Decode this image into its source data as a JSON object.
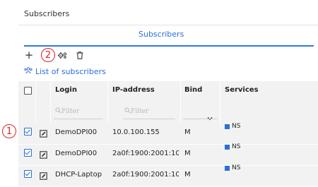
{
  "panel": {
    "title": "Subscribers"
  },
  "tabs": [
    {
      "label": "Subscribers",
      "active": true
    }
  ],
  "toolbar": {
    "add_label": "+",
    "annotation_2": "2"
  },
  "list": {
    "title": "List of subscribers"
  },
  "table": {
    "headers": {
      "login": "Login",
      "ip": "IP-address",
      "bind": "Bind",
      "services": "Services"
    },
    "filter_placeholder": "Filter",
    "rows": [
      {
        "checked": true,
        "login": "DemoDPI00",
        "ip": "10.0.100.155",
        "bind": "M",
        "service": "NS"
      },
      {
        "checked": true,
        "login": "DemoDPI00",
        "ip": "2a0f:1900:2001:10",
        "bind": "M",
        "service": "NS"
      },
      {
        "checked": true,
        "login": "DHCP-Laptop",
        "ip": "2a0f:1900:2001:10",
        "bind": "M",
        "service": "NS"
      }
    ]
  },
  "annotation_1": "1",
  "colors": {
    "accent": "#2a6fd6",
    "annotation": "#e02020",
    "row_bg": "#f2f2f2"
  }
}
